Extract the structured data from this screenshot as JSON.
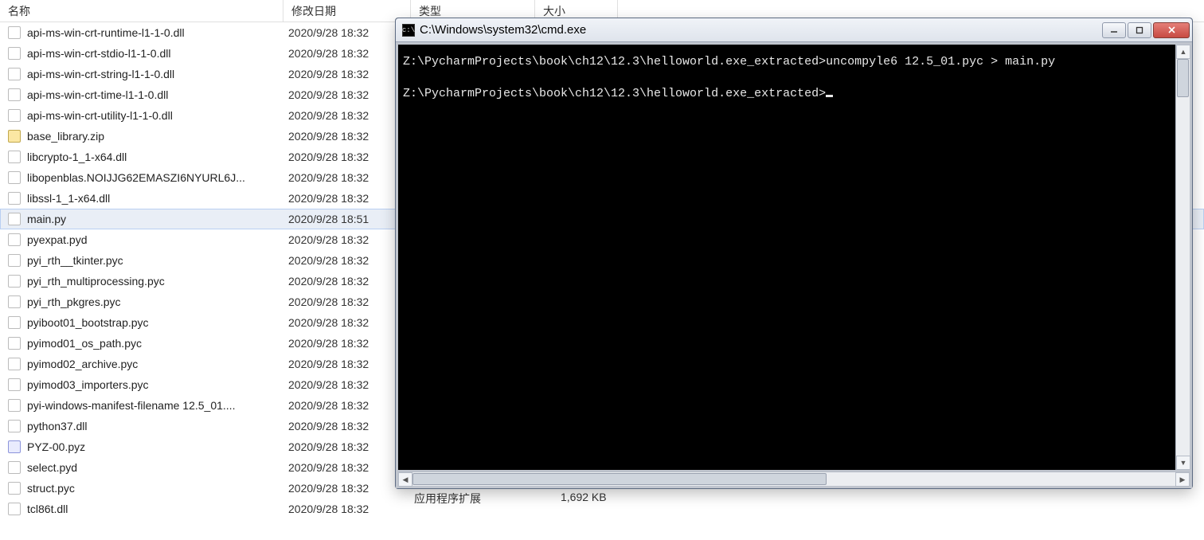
{
  "explorer": {
    "columns": {
      "name": "名称",
      "date": "修改日期",
      "type": "类型",
      "size": "大小"
    },
    "files": [
      {
        "name": "api-ms-win-crt-runtime-l1-1-0.dll",
        "date": "2020/9/28 18:32",
        "icon": "dll",
        "selected": false
      },
      {
        "name": "api-ms-win-crt-stdio-l1-1-0.dll",
        "date": "2020/9/28 18:32",
        "icon": "dll",
        "selected": false
      },
      {
        "name": "api-ms-win-crt-string-l1-1-0.dll",
        "date": "2020/9/28 18:32",
        "icon": "dll",
        "selected": false
      },
      {
        "name": "api-ms-win-crt-time-l1-1-0.dll",
        "date": "2020/9/28 18:32",
        "icon": "dll",
        "selected": false
      },
      {
        "name": "api-ms-win-crt-utility-l1-1-0.dll",
        "date": "2020/9/28 18:32",
        "icon": "dll",
        "selected": false
      },
      {
        "name": "base_library.zip",
        "date": "2020/9/28 18:32",
        "icon": "zip",
        "selected": false
      },
      {
        "name": "libcrypto-1_1-x64.dll",
        "date": "2020/9/28 18:32",
        "icon": "dll",
        "selected": false
      },
      {
        "name": "libopenblas.NOIJJG62EMASZI6NYURL6J...",
        "date": "2020/9/28 18:32",
        "icon": "dll",
        "selected": false
      },
      {
        "name": "libssl-1_1-x64.dll",
        "date": "2020/9/28 18:32",
        "icon": "dll",
        "selected": false
      },
      {
        "name": "main.py",
        "date": "2020/9/28 18:51",
        "icon": "py",
        "selected": true
      },
      {
        "name": "pyexpat.pyd",
        "date": "2020/9/28 18:32",
        "icon": "pyd",
        "selected": false
      },
      {
        "name": "pyi_rth__tkinter.pyc",
        "date": "2020/9/28 18:32",
        "icon": "pyc",
        "selected": false
      },
      {
        "name": "pyi_rth_multiprocessing.pyc",
        "date": "2020/9/28 18:32",
        "icon": "pyc",
        "selected": false
      },
      {
        "name": "pyi_rth_pkgres.pyc",
        "date": "2020/9/28 18:32",
        "icon": "pyc",
        "selected": false
      },
      {
        "name": "pyiboot01_bootstrap.pyc",
        "date": "2020/9/28 18:32",
        "icon": "pyc",
        "selected": false
      },
      {
        "name": "pyimod01_os_path.pyc",
        "date": "2020/9/28 18:32",
        "icon": "pyc",
        "selected": false
      },
      {
        "name": "pyimod02_archive.pyc",
        "date": "2020/9/28 18:32",
        "icon": "pyc",
        "selected": false
      },
      {
        "name": "pyimod03_importers.pyc",
        "date": "2020/9/28 18:32",
        "icon": "pyc",
        "selected": false
      },
      {
        "name": "pyi-windows-manifest-filename 12.5_01....",
        "date": "2020/9/28 18:32",
        "icon": "txt",
        "selected": false
      },
      {
        "name": "python37.dll",
        "date": "2020/9/28 18:32",
        "icon": "dll",
        "selected": false
      },
      {
        "name": "PYZ-00.pyz",
        "date": "2020/9/28 18:32",
        "icon": "pyz",
        "selected": false
      },
      {
        "name": "select.pyd",
        "date": "2020/9/28 18:32",
        "icon": "pyd",
        "selected": false
      },
      {
        "name": "struct.pyc",
        "date": "2020/9/28 18:32",
        "icon": "pyc",
        "selected": false
      },
      {
        "name": "tcl86t.dll",
        "date": "2020/9/28 18:32",
        "icon": "dll",
        "selected": false
      }
    ],
    "peek": {
      "type": "应用程序扩展",
      "size": "1,692 KB"
    }
  },
  "cmd": {
    "title": "C:\\Windows\\system32\\cmd.exe",
    "lines": [
      "Z:\\PycharmProjects\\book\\ch12\\12.3\\helloworld.exe_extracted>uncompyle6 12.5_01.pyc > main.py",
      "",
      "Z:\\PycharmProjects\\book\\ch12\\12.3\\helloworld.exe_extracted>"
    ]
  }
}
